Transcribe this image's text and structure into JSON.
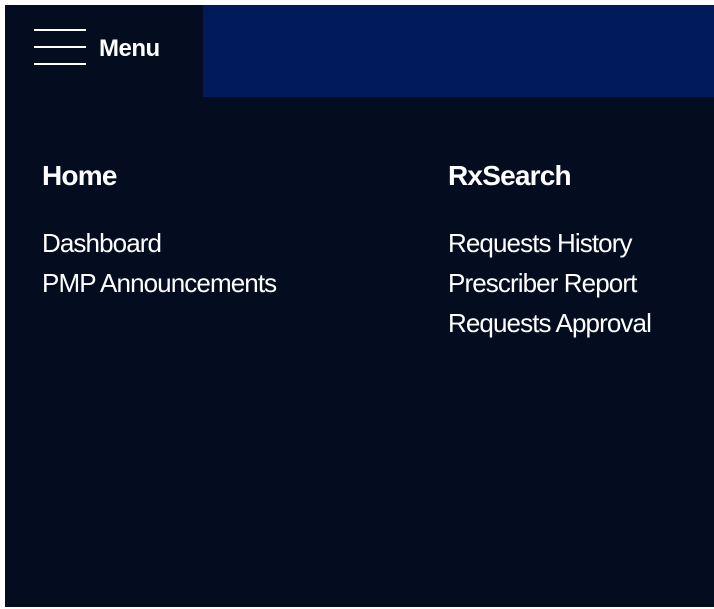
{
  "header": {
    "menu_label": "Menu",
    "menu_icon": "hamburger-icon",
    "colors": {
      "menu_background": "#040d1f",
      "bar_accent": "#001a5b",
      "text": "#ffffff"
    }
  },
  "navigation": {
    "home": {
      "heading": "Home",
      "items": [
        {
          "label": "Dashboard"
        },
        {
          "label": "PMP Announcements"
        }
      ]
    },
    "rxsearch": {
      "heading": "RxSearch",
      "items": [
        {
          "label": "Requests History"
        },
        {
          "label": "Prescriber Report"
        },
        {
          "label": "Requests Approval"
        }
      ]
    }
  }
}
